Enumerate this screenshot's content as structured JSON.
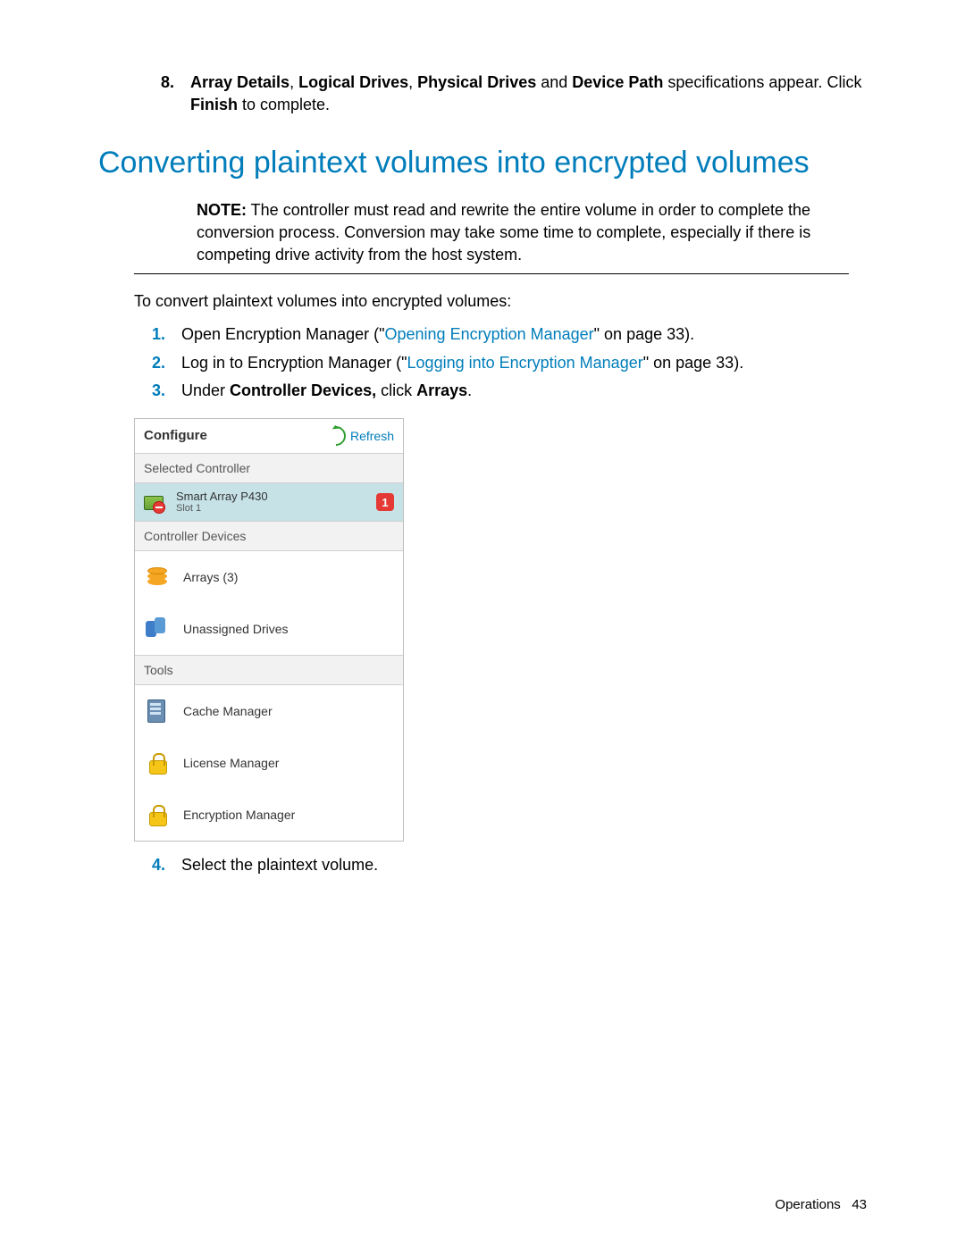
{
  "prev_step": {
    "num": "8.",
    "prefix": "Array Details",
    "sep1": ", ",
    "b2": "Logical Drives",
    "sep2": ", ",
    "b3": "Physical Drives",
    "mid": " and ",
    "b4": "Device Path",
    "tail1": " specifications appear. Click ",
    "b5": "Finish",
    "tail2": " to complete."
  },
  "title": "Converting plaintext volumes into encrypted volumes",
  "note": {
    "label": "NOTE:",
    "text": " The controller must read and rewrite the entire volume in order to complete the conversion process. Conversion may take some time to complete, especially if there is competing drive activity from the host system."
  },
  "intro": "To convert plaintext volumes into encrypted volumes:",
  "steps": [
    {
      "num": "1.",
      "pre": "Open Encryption Manager (\"",
      "link": "Opening Encryption Manager",
      "post": "\" on page 33)."
    },
    {
      "num": "2.",
      "pre": "Log in to Encryption Manager (\"",
      "link": "Logging into Encryption Manager",
      "post": "\" on page 33)."
    },
    {
      "num": "3.",
      "pre": "Under ",
      "b1": "Controller Devices,",
      "mid": " click ",
      "b2": "Arrays",
      "post": "."
    }
  ],
  "panel": {
    "configure": "Configure",
    "refresh": "Refresh",
    "selected_label": "Selected Controller",
    "controller_name": "Smart Array P430",
    "controller_slot": "Slot 1",
    "badge": "1",
    "devices_label": "Controller Devices",
    "arrays": "Arrays (3)",
    "unassigned": "Unassigned Drives",
    "tools_label": "Tools",
    "cache": "Cache Manager",
    "license": "License Manager",
    "encryption": "Encryption Manager"
  },
  "step4": {
    "num": "4.",
    "text": "Select the plaintext volume."
  },
  "footer": {
    "section": "Operations",
    "page": "43"
  }
}
